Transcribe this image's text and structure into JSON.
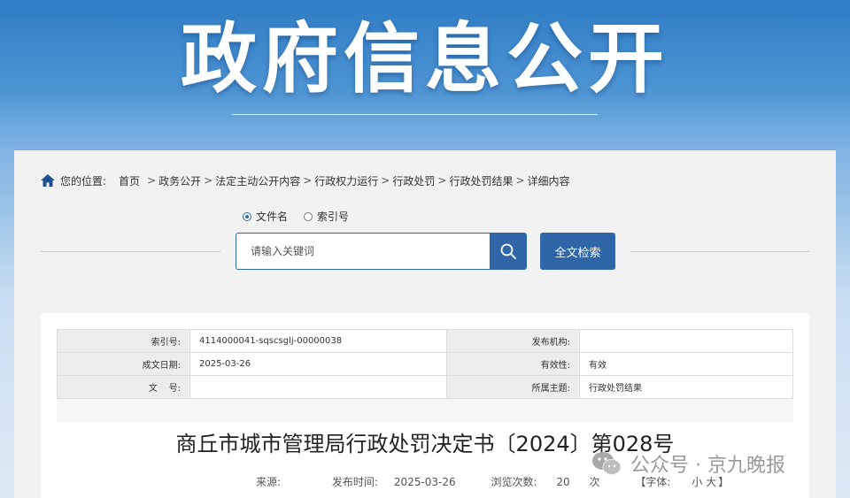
{
  "banner": {
    "title": "政府信息公开"
  },
  "breadcrumb": {
    "prefix": "您的位置:",
    "items": [
      "首页",
      "政务公开",
      "法定主动公开内容",
      "行政权力运行",
      "行政处罚",
      "行政处罚结果",
      "详细内容"
    ],
    "separator": ">"
  },
  "search": {
    "options": [
      {
        "label": "文件名",
        "selected": true
      },
      {
        "label": "索引号",
        "selected": false
      }
    ],
    "placeholder": "请输入关键词",
    "fulltext_label": "全文检索",
    "accent_color": "#2e66a8"
  },
  "meta": {
    "rows": [
      {
        "k1": "索引号:",
        "v1": "4114000041-sqscsglj-00000038",
        "k2": "发布机构:",
        "v2": ""
      },
      {
        "k1": "成文日期:",
        "v1": "2025-03-26",
        "k2": "有效性:",
        "v2": "有效"
      },
      {
        "k1": "文    号:",
        "v1": "",
        "k2": "所属主题:",
        "v2": "行政处罚结果"
      }
    ]
  },
  "document": {
    "title": "商丘市城市管理局行政处罚决定书〔2024〕第028号",
    "source_label": "来源:",
    "source_value": "",
    "publish_label": "发布时间:",
    "publish_value": "2025-03-26",
    "views_label": "浏览次数:",
    "views_value": "20",
    "views_unit": "次",
    "font_label": "【字体:",
    "font_small": "小",
    "font_large": "大",
    "font_close": "】"
  },
  "watermark": {
    "text": "公众号 · 京九晚报"
  }
}
